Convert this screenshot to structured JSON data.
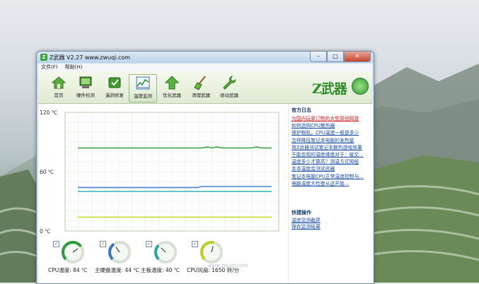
{
  "window": {
    "title": "Z武器 V2.27 www.zwuqi.com",
    "app_icon_letter": "Z",
    "buttons": {
      "minimize": "–",
      "maximize": "□",
      "close": "✕"
    }
  },
  "menu": [
    {
      "label": "文件(F)"
    },
    {
      "label": "帮助(H)"
    }
  ],
  "toolbar": {
    "items": [
      {
        "label": "首页",
        "icon": "home-icon"
      },
      {
        "label": "硬件检测",
        "icon": "hardware-icon"
      },
      {
        "label": "漏洞修复",
        "icon": "patch-icon"
      },
      {
        "label": "温度监测",
        "icon": "temperature-monitor-icon",
        "active": true
      },
      {
        "label": "优化武器",
        "icon": "upload-arrow-icon"
      },
      {
        "label": "清理武器",
        "icon": "broom-icon"
      },
      {
        "label": "驱动武器",
        "icon": "wrench-icon"
      }
    ],
    "brand": "Z武器"
  },
  "chart": {
    "y_ticks": [
      "120 ℃",
      "60 ℃",
      "0 ℃"
    ],
    "watermark": "www.zwuqi.com"
  },
  "chart_data": {
    "type": "line",
    "ylim": [
      0,
      120
    ],
    "yticks": [
      0,
      60,
      120
    ],
    "grid": true,
    "series": [
      {
        "color": "#3fa84a",
        "values": [
          84,
          84,
          84,
          84,
          84,
          84,
          84,
          84,
          84,
          84,
          84,
          84,
          84,
          84,
          84,
          84,
          84,
          84,
          84,
          84,
          84,
          84,
          84,
          84,
          84,
          84,
          85,
          84,
          85,
          84,
          84,
          84,
          84,
          84,
          84,
          84,
          85,
          84,
          84,
          84
        ]
      },
      {
        "color": "#4a7fd6",
        "values": [
          44,
          44,
          44,
          44,
          44,
          44,
          44,
          44,
          44,
          44,
          44,
          44,
          44,
          44,
          44,
          44,
          44,
          44,
          44,
          44,
          44,
          44,
          44,
          44,
          44,
          45,
          45,
          45,
          45,
          45,
          45,
          45,
          45,
          45,
          45,
          45,
          45,
          45,
          45,
          45
        ]
      },
      {
        "color": "#35b2b2",
        "values": [
          40,
          40,
          40,
          40,
          40,
          40,
          40,
          40,
          40,
          40,
          40,
          40,
          40,
          40,
          40,
          40,
          40,
          40,
          40,
          40,
          40,
          40,
          40,
          40,
          40,
          40,
          40,
          40,
          40,
          40,
          40,
          40,
          40,
          40,
          40,
          40,
          40,
          40,
          40,
          40
        ]
      },
      {
        "color": "#c8dc3a",
        "values": [
          14,
          14,
          14,
          14,
          14,
          14,
          14,
          14,
          14,
          14,
          14,
          14,
          14,
          14,
          14,
          14,
          14,
          14,
          14,
          14,
          14,
          14,
          14,
          14,
          14,
          14,
          14,
          14,
          14,
          14,
          14,
          14,
          14,
          14,
          14,
          14,
          14,
          14,
          14,
          14
        ]
      }
    ]
  },
  "gauges": [
    {
      "label": "CPU温度: 84 ℃",
      "level": 0.7,
      "checked": true,
      "color": "#2f9a38"
    },
    {
      "label": "主硬盘温度: 44 ℃",
      "level": 0.37,
      "checked": true,
      "color": "#3a73c9"
    },
    {
      "label": "主板温度: 40 ℃",
      "level": 0.33,
      "checked": true,
      "color": "#2aa6a0"
    },
    {
      "label": "CPU风扇: 1650 转/分",
      "level": 0.55,
      "checked": true,
      "color": "#bccf1e"
    }
  ],
  "sidebar": {
    "news_title": "官方日志",
    "news": [
      {
        "text": "为国内玩家订制的大型原创网游",
        "color": "red"
      },
      {
        "text": "如何选购CPU散热器"
      },
      {
        "text": "保护眼机，CPU温度一般是多少"
      },
      {
        "text": "怎样降低笔记本电脑的发热量"
      },
      {
        "text": "用Z武器测试笔记本散热游戏效果"
      },
      {
        "text": "不能忽视的温度维度对于：缓交..."
      },
      {
        "text": "温度多少才算高？测温方式揭秘"
      },
      {
        "text": "本本温度监测试武器"
      },
      {
        "text": "笔记本电脑CPU正常温度控制与..."
      },
      {
        "text": "电脑温度大检查从这开始..."
      }
    ],
    "quick_title": "快捷操作",
    "quick": [
      {
        "text": "温度监测截屏"
      },
      {
        "text": "保存监测结果"
      }
    ]
  }
}
